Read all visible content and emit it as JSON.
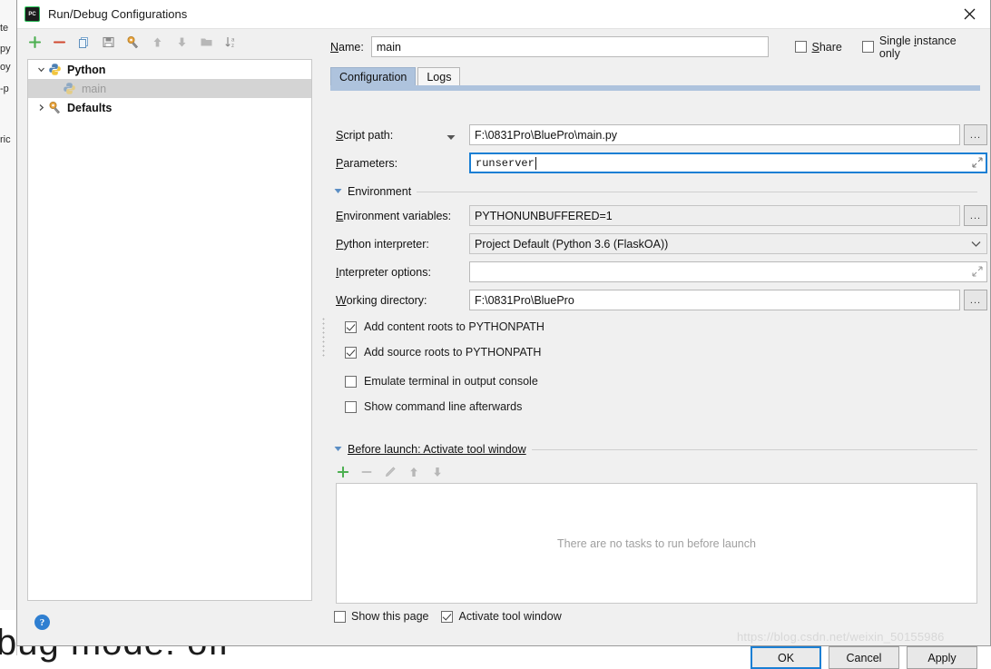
{
  "window": {
    "title": "Run/Debug Configurations",
    "app_icon": "pycharm-icon",
    "close_icon": "close-icon"
  },
  "background": {
    "bottom_text": "bug mode: off",
    "edge_fragments": [
      "te",
      "py",
      "oy",
      "-p",
      "ric"
    ]
  },
  "tree_toolbar": [
    {
      "name": "add-configuration-button",
      "icon": "plus-icon",
      "color": "#4caf50"
    },
    {
      "name": "remove-configuration-button",
      "icon": "minus-icon",
      "color": "#d1492f"
    },
    {
      "name": "copy-configuration-button",
      "icon": "copy-icon",
      "color": "#7aa7d0"
    },
    {
      "name": "save-configuration-button",
      "icon": "save-icon",
      "color": "#8a8a8a"
    },
    {
      "name": "edit-templates-button",
      "icon": "wrench-icon",
      "color": "#c08c32"
    },
    {
      "name": "move-up-button",
      "icon": "arrow-up-icon",
      "color": "#b0b0b0"
    },
    {
      "name": "move-down-button",
      "icon": "arrow-down-icon",
      "color": "#b0b0b0"
    },
    {
      "name": "new-folder-button",
      "icon": "folder-icon",
      "color": "#b0b0b0"
    },
    {
      "name": "sort-alphabetically-button",
      "icon": "sort-az-icon",
      "color": "#8a8a8a"
    }
  ],
  "tree": {
    "nodes": [
      {
        "label": "Python",
        "icon": "python-icon",
        "arrow": "chevron-down-icon",
        "level": 0,
        "selected": false,
        "bold": true
      },
      {
        "label": "main",
        "icon": "python-file-icon",
        "arrow": "",
        "level": 1,
        "selected": true,
        "bold": false
      },
      {
        "label": "Defaults",
        "icon": "wrench-icon",
        "arrow": "chevron-right-icon",
        "level": 0,
        "selected": false,
        "bold": true
      }
    ]
  },
  "help_button": {
    "label": "?",
    "name": "help-button"
  },
  "header": {
    "name_label": "Name:",
    "name_label_mnemonic": "N",
    "name_value": "main",
    "share_label": "Share",
    "share_checked": false,
    "single_instance_label": "Single instance only",
    "single_instance_checked": false
  },
  "tabs": [
    {
      "label": "Configuration",
      "active": true
    },
    {
      "label": "Logs",
      "active": false
    }
  ],
  "form": {
    "script_path_label": "Script path:",
    "script_path_value": "F:\\0831Pro\\BluePro\\main.py",
    "parameters_label": "Parameters:",
    "parameters_value": "runserver",
    "environment_section": "Environment",
    "env_vars_label": "Environment variables:",
    "env_vars_value": "PYTHONUNBUFFERED=1",
    "interpreter_label": "Python interpreter:",
    "interpreter_value": "Project Default (Python 3.6 (FlaskOA))",
    "interpreter_options_label": "Interpreter options:",
    "interpreter_options_value": "",
    "working_dir_label": "Working directory:",
    "working_dir_value": "F:\\0831Pro\\BluePro",
    "browse_label": "...",
    "checkboxes": [
      {
        "label": "Add content roots to PYTHONPATH",
        "checked": true
      },
      {
        "label": "Add source roots to PYTHONPATH",
        "checked": true
      },
      {
        "label": "Emulate terminal in output console",
        "checked": false
      },
      {
        "label": "Show command line afterwards",
        "checked": false
      }
    ]
  },
  "before_launch": {
    "title": "Before launch: Activate tool window",
    "toolbar": [
      {
        "name": "add-task-button",
        "icon": "plus-icon",
        "enabled": true
      },
      {
        "name": "remove-task-button",
        "icon": "minus-icon",
        "enabled": false
      },
      {
        "name": "edit-task-button",
        "icon": "pencil-icon",
        "enabled": false
      },
      {
        "name": "move-task-up-button",
        "icon": "arrow-up-icon",
        "enabled": false
      },
      {
        "name": "move-task-down-button",
        "icon": "arrow-down-icon",
        "enabled": false
      }
    ],
    "empty_text": "There are no tasks to run before launch",
    "show_page_label": "Show this page",
    "show_page_checked": false,
    "activate_window_label": "Activate tool window",
    "activate_window_checked": true
  },
  "buttons": {
    "ok": "OK",
    "cancel": "Cancel",
    "apply": "Apply"
  },
  "watermark": "https://blog.csdn.net/weixin_50155986",
  "colors": {
    "accent": "#1a7fd4",
    "tab_active": "#aec3dd",
    "dialog_bg": "#f0f0f0",
    "green": "#4caf50",
    "red": "#d1492f"
  }
}
